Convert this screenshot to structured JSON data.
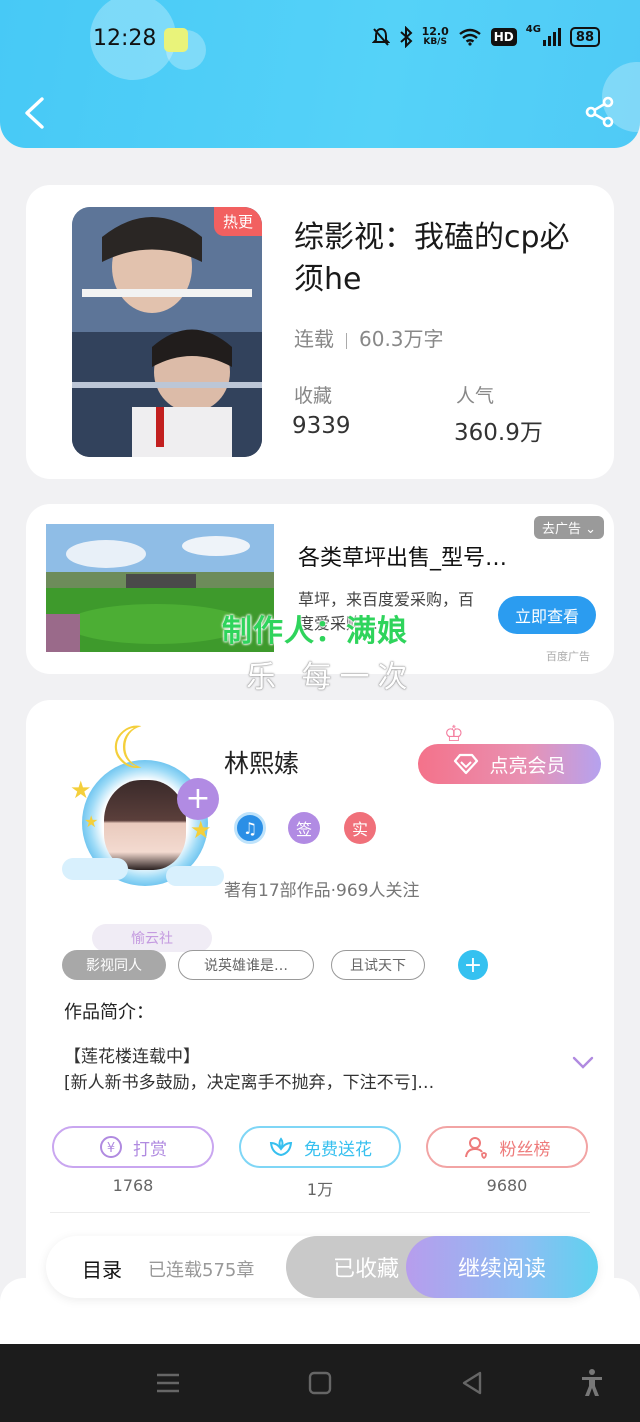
{
  "status_bar": {
    "time": "12:28",
    "net_speed_value": "12.0",
    "net_speed_unit": "KB/S",
    "hd_label": "HD",
    "signal_label": "4G",
    "battery": "88"
  },
  "header": {
    "back_icon": "chevron-left-icon",
    "share_icon": "share-icon",
    "bg_color": "#4fcbf7"
  },
  "book": {
    "badge": "热更",
    "title": "综影视：我磕的cp必须he",
    "status": "连载",
    "word_count": "60.3万字",
    "stats": [
      {
        "label": "收藏",
        "value": "9339"
      },
      {
        "label": "人气",
        "value": "360.9万"
      }
    ]
  },
  "ad": {
    "close_label": "去广告",
    "title": "各类草坪出售_型号…",
    "description": "草坪，来百度爱采购，百度爱采购…",
    "cta_label": "立即查看",
    "source": "百度广告"
  },
  "watermark": {
    "line1": "制作人：满娘",
    "line2": "乐 每一次"
  },
  "author": {
    "name": "林熙嫊",
    "club_badge": "愉云社",
    "vip_button": "点亮会员",
    "badges": [
      {
        "text": "♫",
        "color": "#2b8fe6"
      },
      {
        "text": "签",
        "color": "#b18be3"
      },
      {
        "text": "实",
        "color": "#f0707a"
      }
    ],
    "stats_text": "著有17部作品·969人关注",
    "tags": [
      "影视同人",
      "说英雄谁是…",
      "且试天下"
    ],
    "intro_label": "作品简介：",
    "intro_lines": [
      "【莲花楼连载中】",
      "[新人新书多鼓励，决定离手不抛弃，下注不亏]…"
    ],
    "actions": [
      {
        "label": "打赏",
        "count": "1768",
        "icon": "yen-coin-icon",
        "color": "#b08ae0"
      },
      {
        "label": "免费送花",
        "count": "1万",
        "icon": "flower-icon",
        "color": "#37c0ef"
      },
      {
        "label": "粉丝榜",
        "count": "9680",
        "icon": "fans-user-icon",
        "color": "#ee7b7b"
      }
    ]
  },
  "bottom_bar": {
    "catalog": "目录",
    "chapters": "已连载575章",
    "collected": "已收藏",
    "read": "继续阅读"
  }
}
